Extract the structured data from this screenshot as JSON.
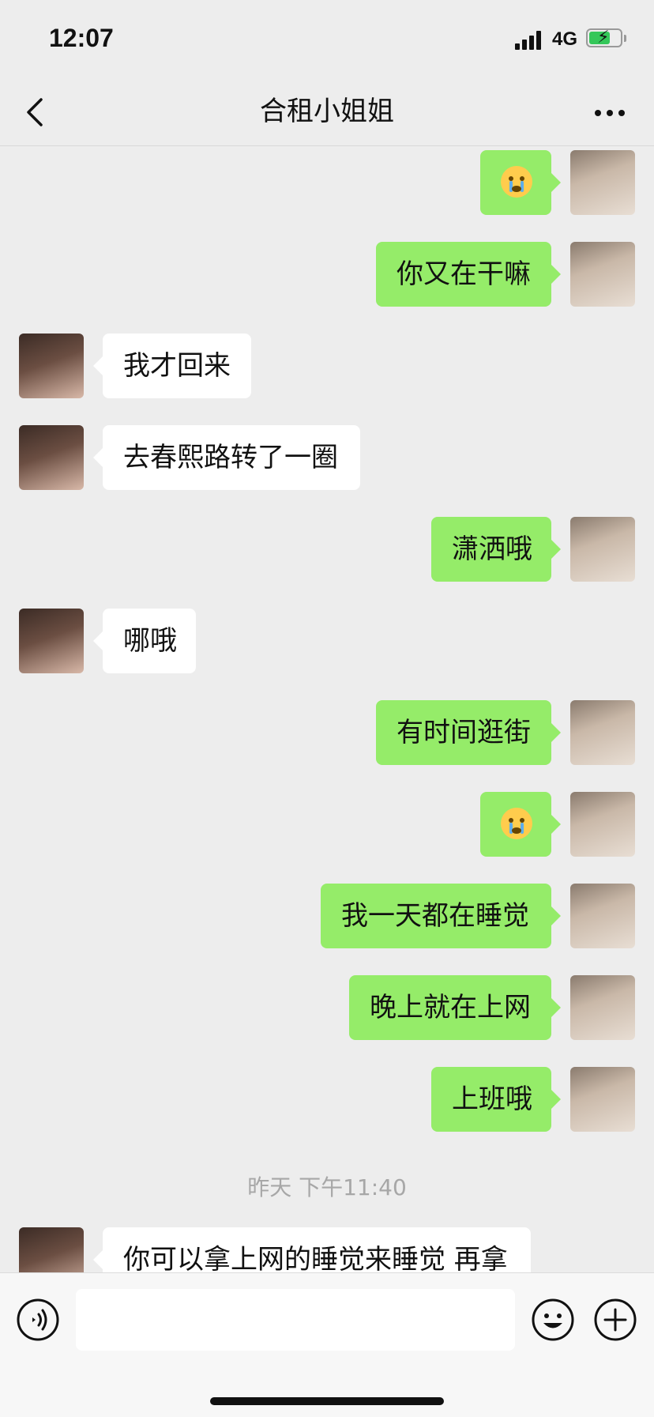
{
  "status_bar": {
    "time": "12:07",
    "network": "4G"
  },
  "header": {
    "title": "合租小姐姐"
  },
  "messages": [
    {
      "from": "me",
      "type": "emoji",
      "emoji": "crying-face"
    },
    {
      "from": "me",
      "type": "text",
      "text": "你又在干嘛"
    },
    {
      "from": "her",
      "type": "text",
      "text": "我才回来"
    },
    {
      "from": "her",
      "type": "text",
      "text": "去春熙路转了一圈"
    },
    {
      "from": "me",
      "type": "text",
      "text": "潇洒哦"
    },
    {
      "from": "her",
      "type": "text",
      "text": "哪哦"
    },
    {
      "from": "me",
      "type": "text",
      "text": "有时间逛街"
    },
    {
      "from": "me",
      "type": "emoji",
      "emoji": "crying-face"
    },
    {
      "from": "me",
      "type": "text",
      "text": "我一天都在睡觉"
    },
    {
      "from": "me",
      "type": "text",
      "text": "晚上就在上网"
    },
    {
      "from": "me",
      "type": "text",
      "text": "上班哦"
    },
    {
      "from": "her",
      "type": "text",
      "text": "你可以拿上网的睡觉来睡觉 再拿"
    }
  ],
  "time_divider": "昨天 下午11:40",
  "input_bar": {
    "text": "",
    "icons": [
      "voice-icon",
      "emoji-icon",
      "plus-icon"
    ]
  },
  "colors": {
    "background": "#ededed",
    "my_bubble": "#95ec69",
    "her_bubble": "#ffffff"
  }
}
